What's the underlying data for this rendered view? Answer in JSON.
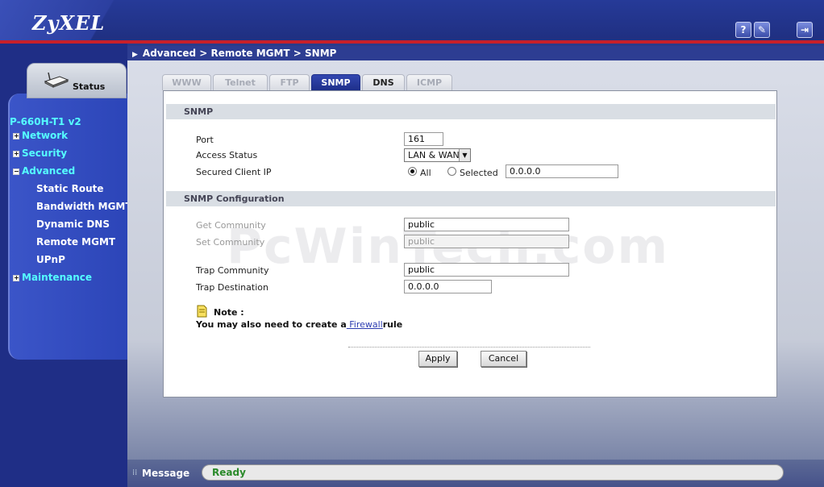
{
  "header": {
    "logo": "ZyXEL",
    "icons": [
      "help-icon",
      "wizard-icon",
      "logout-icon"
    ]
  },
  "breadcrumb": "Advanced > Remote MGMT > SNMP",
  "sidebar": {
    "status_label": "Status",
    "model": "P-660H-T1 v2",
    "items": [
      {
        "label": "Network",
        "expanded": false
      },
      {
        "label": "Security",
        "expanded": false
      },
      {
        "label": "Advanced",
        "expanded": true
      },
      {
        "label": "Maintenance",
        "expanded": false
      }
    ],
    "subitems": [
      "Static Route",
      "Bandwidth MGMT",
      "Dynamic DNS",
      "Remote MGMT",
      "UPnP"
    ]
  },
  "tabs": [
    {
      "label": "WWW",
      "state": "disabled"
    },
    {
      "label": "Telnet",
      "state": "disabled"
    },
    {
      "label": "FTP",
      "state": "disabled"
    },
    {
      "label": "SNMP",
      "state": "active"
    },
    {
      "label": "DNS",
      "state": "normal"
    },
    {
      "label": "ICMP",
      "state": "disabled"
    }
  ],
  "snmp": {
    "section_title": "SNMP",
    "port_label": "Port",
    "port_value": "161",
    "access_label": "Access Status",
    "access_value": "LAN & WAN",
    "client_label": "Secured Client IP",
    "radio_all": "All",
    "radio_selected": "Selected",
    "selected_ip": "0.0.0.0"
  },
  "config": {
    "section_title": "SNMP Configuration",
    "get_label": "Get Community",
    "get_value": "public",
    "set_label": "Set Community",
    "set_value": "public",
    "trap_label": "Trap  Community",
    "trap_value": "public",
    "dest_label": "Trap  Destination",
    "dest_value": "0.0.0.0"
  },
  "watermark": "PcWinTech.com",
  "note": {
    "title": "Note :",
    "text_before": "You may also need to create a",
    "link": " Firewall",
    "text_after": "rule"
  },
  "buttons": {
    "apply": "Apply",
    "cancel": "Cancel"
  },
  "statusbar": {
    "label": "Message",
    "value": "Ready"
  }
}
